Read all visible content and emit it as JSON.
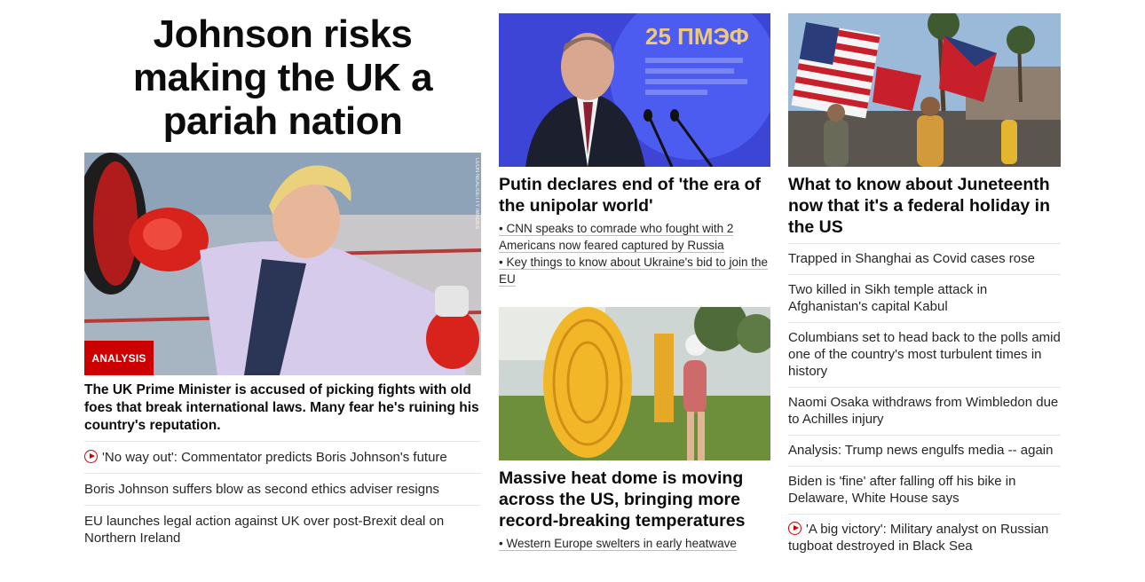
{
  "left": {
    "headline": "Johnson risks making the UK a pariah nation",
    "badge": "ANALYSIS",
    "summary": "The UK Prime Minister is accused of picking fights with old foes that break international laws. Many fear he's ruining his country's reputation.",
    "links": [
      {
        "text": "'No way out': Commentator predicts Boris Johnson's future",
        "video": true
      },
      {
        "text": "Boris Johnson suffers blow as second ethics adviser resigns",
        "video": false
      },
      {
        "text": "EU launches legal action against UK over post-Brexit deal on Northern Ireland",
        "video": false
      }
    ]
  },
  "middle": {
    "story1": {
      "headline": "Putin declares end of 'the era of the unipolar world'",
      "sublinks": [
        "• CNN speaks to comrade who fought with 2 Americans now feared captured by Russia",
        "• Key things to know about Ukraine's bid to join the EU"
      ],
      "image_text": "25 ПМЭФ"
    },
    "story2": {
      "headline": "Massive heat dome is moving across the US, bringing more record-breaking temperatures",
      "sublinks": [
        "• Western Europe swelters in early heatwave"
      ]
    }
  },
  "right": {
    "headline": "What to know about Juneteenth now that it's a federal holiday in the US",
    "links": [
      {
        "text": "Trapped in Shanghai as Covid cases rose",
        "video": false
      },
      {
        "text": "Two killed in Sikh temple attack in Afghanistan's capital Kabul",
        "video": false
      },
      {
        "text": "Columbians set to head back to the polls amid one of the country's most turbulent times in history",
        "video": false
      },
      {
        "text": "Naomi Osaka withdraws from Wimbledon due to Achilles injury",
        "video": false
      },
      {
        "text": "Analysis: Trump news engulfs media -- again",
        "video": false
      },
      {
        "text": "Biden is 'fine' after falling off his bike in Delaware, White House says",
        "video": false
      },
      {
        "text": "'A big victory': Military analyst on Russian tugboat destroyed in Black Sea",
        "video": true
      }
    ]
  },
  "colors": {
    "accent": "#cc0000",
    "text": "#0c0c0c",
    "divider": "#e6e6e6"
  }
}
